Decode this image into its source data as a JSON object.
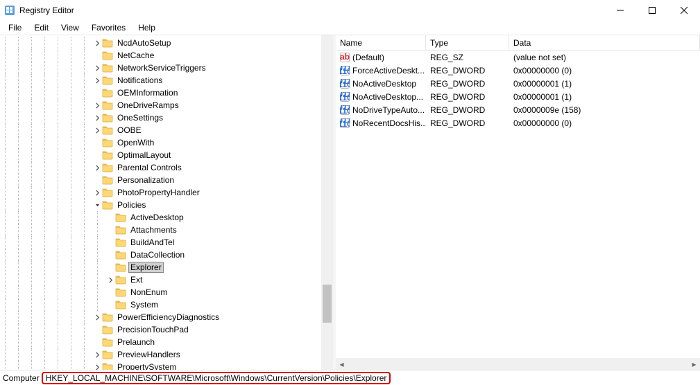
{
  "window": {
    "title": "Registry Editor"
  },
  "menu": {
    "file": "File",
    "edit": "Edit",
    "view": "View",
    "favorites": "Favorites",
    "help": "Help"
  },
  "tree_nodes": [
    {
      "depth": 7,
      "exp": "closed",
      "label": "NcdAutoSetup"
    },
    {
      "depth": 7,
      "exp": "none",
      "label": "NetCache"
    },
    {
      "depth": 7,
      "exp": "closed",
      "label": "NetworkServiceTriggers"
    },
    {
      "depth": 7,
      "exp": "closed",
      "label": "Notifications"
    },
    {
      "depth": 7,
      "exp": "none",
      "label": "OEMInformation"
    },
    {
      "depth": 7,
      "exp": "closed",
      "label": "OneDriveRamps"
    },
    {
      "depth": 7,
      "exp": "closed",
      "label": "OneSettings"
    },
    {
      "depth": 7,
      "exp": "closed",
      "label": "OOBE"
    },
    {
      "depth": 7,
      "exp": "none",
      "label": "OpenWith"
    },
    {
      "depth": 7,
      "exp": "none",
      "label": "OptimalLayout"
    },
    {
      "depth": 7,
      "exp": "closed",
      "label": "Parental Controls"
    },
    {
      "depth": 7,
      "exp": "none",
      "label": "Personalization"
    },
    {
      "depth": 7,
      "exp": "closed",
      "label": "PhotoPropertyHandler"
    },
    {
      "depth": 7,
      "exp": "open",
      "label": "Policies"
    },
    {
      "depth": 8,
      "exp": "none",
      "label": "ActiveDesktop"
    },
    {
      "depth": 8,
      "exp": "none",
      "label": "Attachments"
    },
    {
      "depth": 8,
      "exp": "none",
      "label": "BuildAndTel"
    },
    {
      "depth": 8,
      "exp": "none",
      "label": "DataCollection"
    },
    {
      "depth": 8,
      "exp": "none",
      "label": "Explorer",
      "selected": true
    },
    {
      "depth": 8,
      "exp": "closed",
      "label": "Ext"
    },
    {
      "depth": 8,
      "exp": "none",
      "label": "NonEnum"
    },
    {
      "depth": 8,
      "exp": "none",
      "label": "System"
    },
    {
      "depth": 7,
      "exp": "closed",
      "label": "PowerEfficiencyDiagnostics"
    },
    {
      "depth": 7,
      "exp": "none",
      "label": "PrecisionTouchPad"
    },
    {
      "depth": 7,
      "exp": "none",
      "label": "Prelaunch"
    },
    {
      "depth": 7,
      "exp": "closed",
      "label": "PreviewHandlers"
    },
    {
      "depth": 7,
      "exp": "closed",
      "label": "PropertySystem"
    }
  ],
  "values_header": {
    "name": "Name",
    "type": "Type",
    "data": "Data"
  },
  "values": [
    {
      "icon": "sz",
      "name": "(Default)",
      "type": "REG_SZ",
      "data": "(value not set)"
    },
    {
      "icon": "bin",
      "name": "ForceActiveDeskt...",
      "type": "REG_DWORD",
      "data": "0x00000000 (0)"
    },
    {
      "icon": "bin",
      "name": "NoActiveDesktop",
      "type": "REG_DWORD",
      "data": "0x00000001 (1)"
    },
    {
      "icon": "bin",
      "name": "NoActiveDesktop...",
      "type": "REG_DWORD",
      "data": "0x00000001 (1)"
    },
    {
      "icon": "bin",
      "name": "NoDriveTypeAuto...",
      "type": "REG_DWORD",
      "data": "0x0000009e (158)"
    },
    {
      "icon": "bin",
      "name": "NoRecentDocsHis...",
      "type": "REG_DWORD",
      "data": "0x00000000 (0)"
    }
  ],
  "status": {
    "label": "Computer",
    "path": "HKEY_LOCAL_MACHINE\\SOFTWARE\\Microsoft\\Windows\\CurrentVersion\\Policies\\Explorer"
  }
}
